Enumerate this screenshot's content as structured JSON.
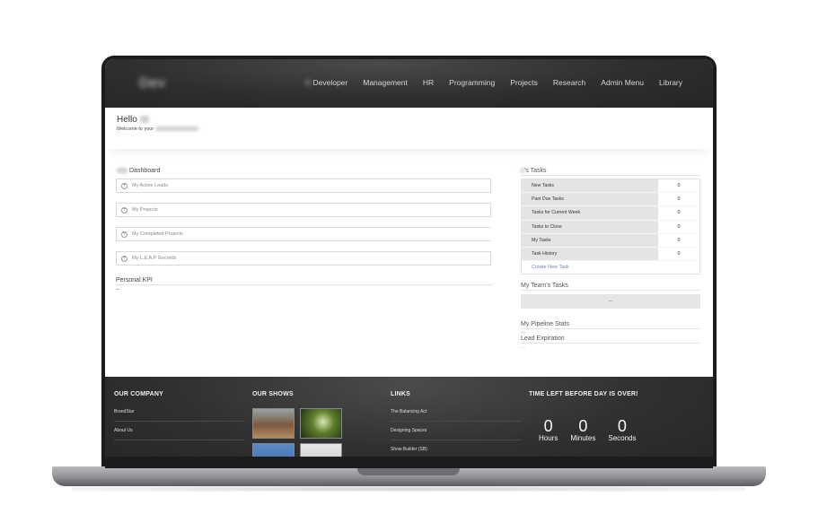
{
  "header": {
    "brand": "Dev",
    "nav": [
      "Developer",
      "Management",
      "HR",
      "Programming",
      "Projects",
      "Research",
      "Admin Menu",
      "Library"
    ]
  },
  "hello": {
    "title": "Hello",
    "subtitle": "Welcome to your"
  },
  "dashboard": {
    "title": "Dashboard",
    "accordions": [
      "My Active Leads",
      "My Projects",
      "My Completed Projects",
      "My L.E.A.P Records"
    ],
    "kpi_title": "Personal KPI",
    "kpi_value": "--"
  },
  "tasks": {
    "title": "'s Tasks",
    "rows": [
      {
        "label": "New Tasks",
        "count": "0"
      },
      {
        "label": "Past Due Tasks",
        "count": "0"
      },
      {
        "label": "Tasks for Current Week",
        "count": "0"
      },
      {
        "label": "Tasks to Close",
        "count": "0"
      },
      {
        "label": "My Tasks",
        "count": "0"
      },
      {
        "label": "Task History",
        "count": "0"
      }
    ],
    "create_label": "Create New Task",
    "team_title": "My Team's Tasks",
    "team_value": "...",
    "pipeline_title": "My Pipeline Stats",
    "pipeline_value": "...",
    "lead_title": "Lead Expiration",
    "lead_value": "..."
  },
  "footer": {
    "company_title": "OUR COMPANY",
    "company_links": [
      "BrandStar",
      "About Us"
    ],
    "shows_title": "OUR SHOWS",
    "links_title": "LINKS",
    "links": [
      "The Balancing Act",
      "Designing Spaces",
      "Show Builder (SB)"
    ],
    "countdown_title": "TIME LEFT BEFORE DAY IS OVER!",
    "countdown": [
      {
        "value": "0",
        "label": "Hours"
      },
      {
        "value": "0",
        "label": "Minutes"
      },
      {
        "value": "0",
        "label": "Seconds"
      }
    ]
  }
}
